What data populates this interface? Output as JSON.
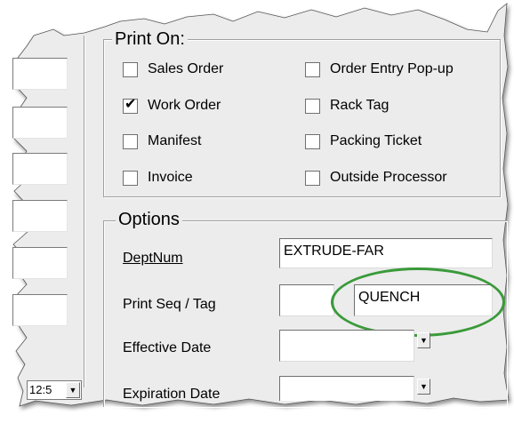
{
  "print_on": {
    "legend": "Print On:",
    "items": [
      {
        "label": "Sales Order",
        "checked": false
      },
      {
        "label": "Order Entry Pop-up",
        "checked": false
      },
      {
        "label": "Work Order",
        "checked": true
      },
      {
        "label": "Rack Tag",
        "checked": false
      },
      {
        "label": "Manifest",
        "checked": false
      },
      {
        "label": "Packing Ticket",
        "checked": false
      },
      {
        "label": "Invoice",
        "checked": false
      },
      {
        "label": "Outside Processor",
        "checked": false
      }
    ],
    "check_glyph": "✔"
  },
  "options": {
    "legend": "Options",
    "dept_num": {
      "label": "DeptNum",
      "value": "EXTRUDE-FAR"
    },
    "print_seq_tag": {
      "label": "Print Seq / Tag",
      "seq_value": "",
      "tag_value": "QUENCH"
    },
    "effective_date": {
      "label": "Effective Date",
      "value": ""
    },
    "expiration_date": {
      "label": "Expiration Date",
      "value": ""
    },
    "dropdown_glyph": "▼"
  },
  "left_panel": {
    "cut_combo_value": "12:5",
    "dropdown_glyph": "▼"
  },
  "colors": {
    "panel_bg": "#ececec",
    "highlight_ring": "#3a9a3a"
  }
}
